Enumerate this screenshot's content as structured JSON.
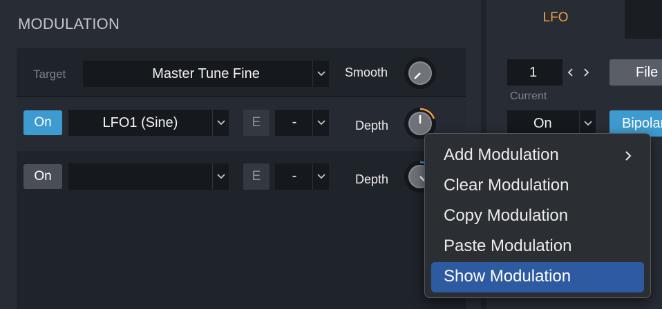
{
  "modulation": {
    "title": "MODULATION",
    "target_label": "Target",
    "target_value": "Master Tune Fine",
    "smooth_label": "Smooth",
    "slots": [
      {
        "on_label": "On",
        "source": "LFO1 (Sine)",
        "e_label": "E",
        "via": "-",
        "depth_label": "Depth",
        "active": true
      },
      {
        "on_label": "On",
        "source": "",
        "e_label": "E",
        "via": "-",
        "depth_label": "Depth",
        "active": false
      }
    ]
  },
  "lfo": {
    "tab_label": "LFO",
    "number": "1",
    "file_label": "File",
    "current_label": "Current",
    "current_value": "On",
    "bipolar_label": "Bipolar"
  },
  "context_menu": {
    "items": [
      {
        "label": "Add Modulation",
        "submenu": true
      },
      {
        "label": "Clear Modulation"
      },
      {
        "label": "Copy Modulation"
      },
      {
        "label": "Paste Modulation"
      },
      {
        "label": "Show Modulation",
        "highlighted": true
      }
    ]
  },
  "colors": {
    "accent_blue": "#3e9bd0",
    "lfo_tab_orange": "#f0a040",
    "menu_highlight": "#2d5aa0"
  }
}
